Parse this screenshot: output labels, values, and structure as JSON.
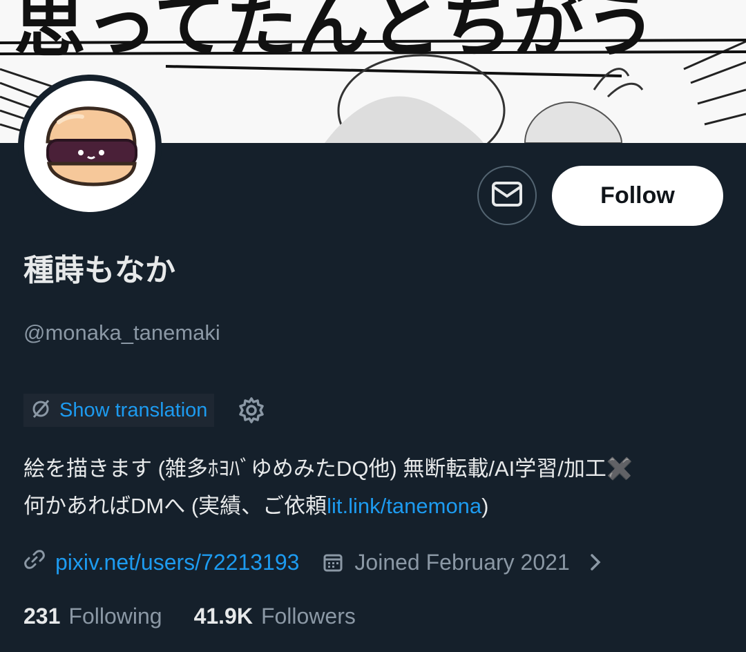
{
  "banner": {
    "lettering": "思ってたんとちがう"
  },
  "profile": {
    "display_name": "種蒔もなか",
    "handle": "@monaka_tanemaki",
    "follow_label": "Follow",
    "translate_label": "Show translation",
    "bio_line1": "絵を描きます (雑多ﾎﾖﾊﾞゆめみたDQ他) 無断転載/AI学習/加工✖️",
    "bio_line2_text": "何かあればDMへ (実績、ご依頼",
    "bio_line2_link": "lit.link/tanemona",
    "bio_line2_close": ")",
    "website": "pixiv.net/users/72213193",
    "joined": "Joined February 2021",
    "following_count": "231",
    "following_label": "Following",
    "followers_count": "41.9K",
    "followers_label": "Followers"
  },
  "icons": {
    "dm": "envelope-icon",
    "translate": "translate-icon",
    "settings": "gear-icon",
    "link": "link-icon",
    "calendar": "calendar-icon",
    "chevron": "chevron-right-icon"
  },
  "colors": {
    "background": "#15202b",
    "accent": "#1d9bf0",
    "secondary_text": "#8b98a5",
    "primary_text": "#e7e9ea"
  }
}
